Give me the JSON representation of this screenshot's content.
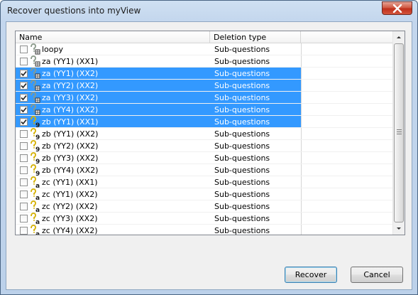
{
  "window": {
    "title": "Recover questions into myView"
  },
  "columns": {
    "name": "Name",
    "deletion_type": "Deletion type"
  },
  "rows": [
    {
      "label": "loopy",
      "type": "Sub-questions",
      "checked": false,
      "selected": false,
      "icon": "question-grid-icon"
    },
    {
      "label": "za (YY1) (XX1)",
      "type": "Sub-questions",
      "checked": false,
      "selected": false,
      "icon": "question-grid-icon"
    },
    {
      "label": "za (YY1) (XX2)",
      "type": "Sub-questions",
      "checked": true,
      "selected": true,
      "icon": "question-grid-icon"
    },
    {
      "label": "za (YY2) (XX2)",
      "type": "Sub-questions",
      "checked": true,
      "selected": true,
      "icon": "question-grid-icon"
    },
    {
      "label": "za (YY3) (XX2)",
      "type": "Sub-questions",
      "checked": true,
      "selected": true,
      "icon": "question-grid-icon"
    },
    {
      "label": "za (YY4) (XX2)",
      "type": "Sub-questions",
      "checked": true,
      "selected": true,
      "icon": "question-grid-icon"
    },
    {
      "label": "zb (YY1) (XX1)",
      "type": "Sub-questions",
      "checked": true,
      "selected": true,
      "icon": "question-9-icon"
    },
    {
      "label": "zb (YY1) (XX2)",
      "type": "Sub-questions",
      "checked": false,
      "selected": false,
      "icon": "question-9-icon"
    },
    {
      "label": "zb (YY2) (XX2)",
      "type": "Sub-questions",
      "checked": false,
      "selected": false,
      "icon": "question-9-icon"
    },
    {
      "label": "zb (YY3) (XX2)",
      "type": "Sub-questions",
      "checked": false,
      "selected": false,
      "icon": "question-9-icon"
    },
    {
      "label": "zb (YY4) (XX2)",
      "type": "Sub-questions",
      "checked": false,
      "selected": false,
      "icon": "question-9-icon"
    },
    {
      "label": "zc (YY1) (XX1)",
      "type": "Sub-questions",
      "checked": false,
      "selected": false,
      "icon": "question-a-icon"
    },
    {
      "label": "zc (YY1) (XX2)",
      "type": "Sub-questions",
      "checked": false,
      "selected": false,
      "icon": "question-a-icon"
    },
    {
      "label": "zc (YY2) (XX2)",
      "type": "Sub-questions",
      "checked": false,
      "selected": false,
      "icon": "question-a-icon"
    },
    {
      "label": "zc (YY3) (XX2)",
      "type": "Sub-questions",
      "checked": false,
      "selected": false,
      "icon": "question-a-icon"
    },
    {
      "label": "zc (YY4) (XX2)",
      "type": "Sub-questions",
      "checked": false,
      "selected": false,
      "icon": "question-a-icon"
    }
  ],
  "buttons": {
    "recover": "Recover",
    "cancel": "Cancel"
  },
  "colors": {
    "selection": "#3399ff",
    "close_button": "#c0301c"
  }
}
